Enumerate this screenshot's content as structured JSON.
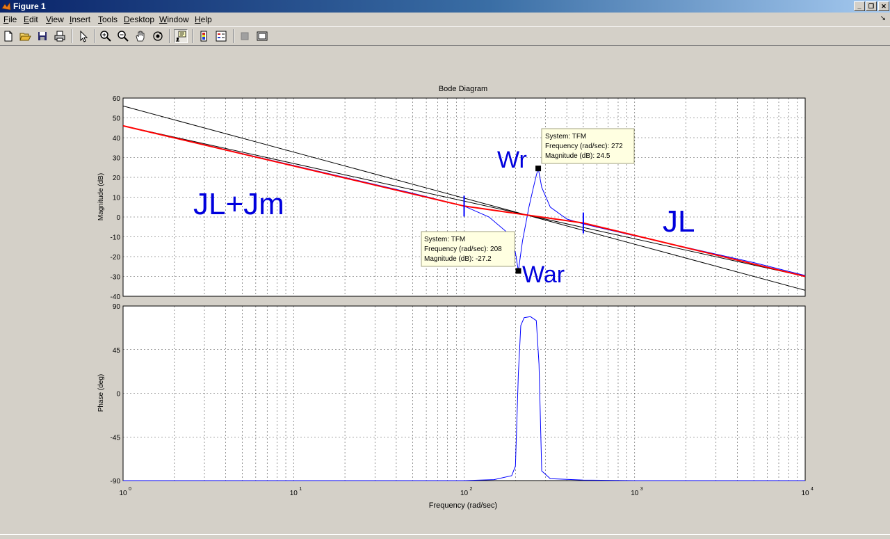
{
  "window": {
    "title": "Figure 1",
    "buttons": [
      "_",
      "❐",
      "✕"
    ]
  },
  "menu": [
    "File",
    "Edit",
    "View",
    "Insert",
    "Tools",
    "Desktop",
    "Window",
    "Help"
  ],
  "menu_underline": [
    "F",
    "E",
    "V",
    "I",
    "T",
    "D",
    "W",
    "H"
  ],
  "toolbar_icons": [
    "new-figure-icon",
    "open-file-icon",
    "save-icon",
    "print-icon",
    "edit-plot-arrow-icon",
    "zoom-in-icon",
    "zoom-out-icon",
    "pan-hand-icon",
    "rotate-3d-icon",
    "data-cursor-icon",
    "colorbar-icon",
    "legend-icon",
    "hide-plot-tools-icon",
    "show-plot-tools-icon"
  ],
  "plot": {
    "title": "Bode Diagram",
    "xlabel": "Frequency  (rad/sec)",
    "mag_ylabel": "Magnitude (dB)",
    "phase_ylabel": "Phase (deg)",
    "annotations": {
      "jl_jm": "JL+Jm",
      "jl": "JL",
      "wr": "Wr",
      "war": "War"
    },
    "datatip_peak": {
      "line1": "System: TFM",
      "line2": "Frequency (rad/sec): 272",
      "line3": "Magnitude (dB): 24.5"
    },
    "datatip_notch": {
      "line1": "System: TFM",
      "line2": "Frequency (rad/sec): 208",
      "line3": "Magnitude (dB): -27.2"
    }
  },
  "chart_data": [
    {
      "type": "line",
      "title": "Bode Diagram",
      "xlabel": "Frequency  (rad/sec)",
      "ylabel": "Magnitude (dB)",
      "xscale": "log",
      "xlim": [
        1,
        10000
      ],
      "ylim": [
        -40,
        60
      ],
      "yticks": [
        -40,
        -30,
        -20,
        -10,
        0,
        10,
        20,
        30,
        40,
        50,
        60
      ],
      "xticks": [
        "10^0",
        "10^1",
        "10^2",
        "10^3",
        "10^4"
      ],
      "grid": true,
      "series": [
        {
          "color": "#0000ff",
          "style": "TFM response",
          "x": [
            1,
            10,
            50,
            100,
            140,
            180,
            200,
            208,
            220,
            240,
            255,
            265,
            272,
            285,
            320,
            400,
            500,
            1000,
            5000,
            10000
          ],
          "y": [
            46,
            26,
            12,
            5.5,
            0,
            -8,
            -18,
            -27.2,
            -12,
            5,
            15,
            21,
            24.5,
            15,
            5,
            -1,
            -3.5,
            -9.5,
            -23,
            -29.5
          ]
        },
        {
          "color": "#ff0000",
          "style": "asymptote",
          "x": [
            1,
            100,
            500,
            10000
          ],
          "y": [
            46,
            5.5,
            -3,
            -30
          ]
        },
        {
          "color": "#000000",
          "style": "JL+Jm slope",
          "x": [
            1,
            10000
          ],
          "y": [
            46,
            -30
          ]
        },
        {
          "color": "#000000",
          "style": "JL slope",
          "x": [
            1,
            10000
          ],
          "y": [
            56,
            -37
          ]
        }
      ],
      "markers": [
        {
          "x": 100,
          "label": "|"
        },
        {
          "x": 500,
          "label": "|"
        }
      ],
      "datatips": [
        {
          "x": 272,
          "y": 24.5
        },
        {
          "x": 208,
          "y": -27.2
        }
      ]
    },
    {
      "type": "line",
      "xlabel": "Frequency  (rad/sec)",
      "ylabel": "Phase (deg)",
      "xscale": "log",
      "xlim": [
        1,
        10000
      ],
      "ylim": [
        -90,
        90
      ],
      "yticks": [
        -90,
        -45,
        0,
        45,
        90
      ],
      "grid": true,
      "series": [
        {
          "color": "#0000ff",
          "x": [
            1,
            100,
            150,
            190,
            200,
            208,
            215,
            225,
            245,
            265,
            275,
            285,
            320,
            500,
            1000,
            10000
          ],
          "y": [
            -90,
            -90,
            -89,
            -85,
            -75,
            20,
            70,
            78,
            79,
            75,
            30,
            -80,
            -88,
            -89.5,
            -90,
            -90
          ]
        }
      ]
    }
  ]
}
